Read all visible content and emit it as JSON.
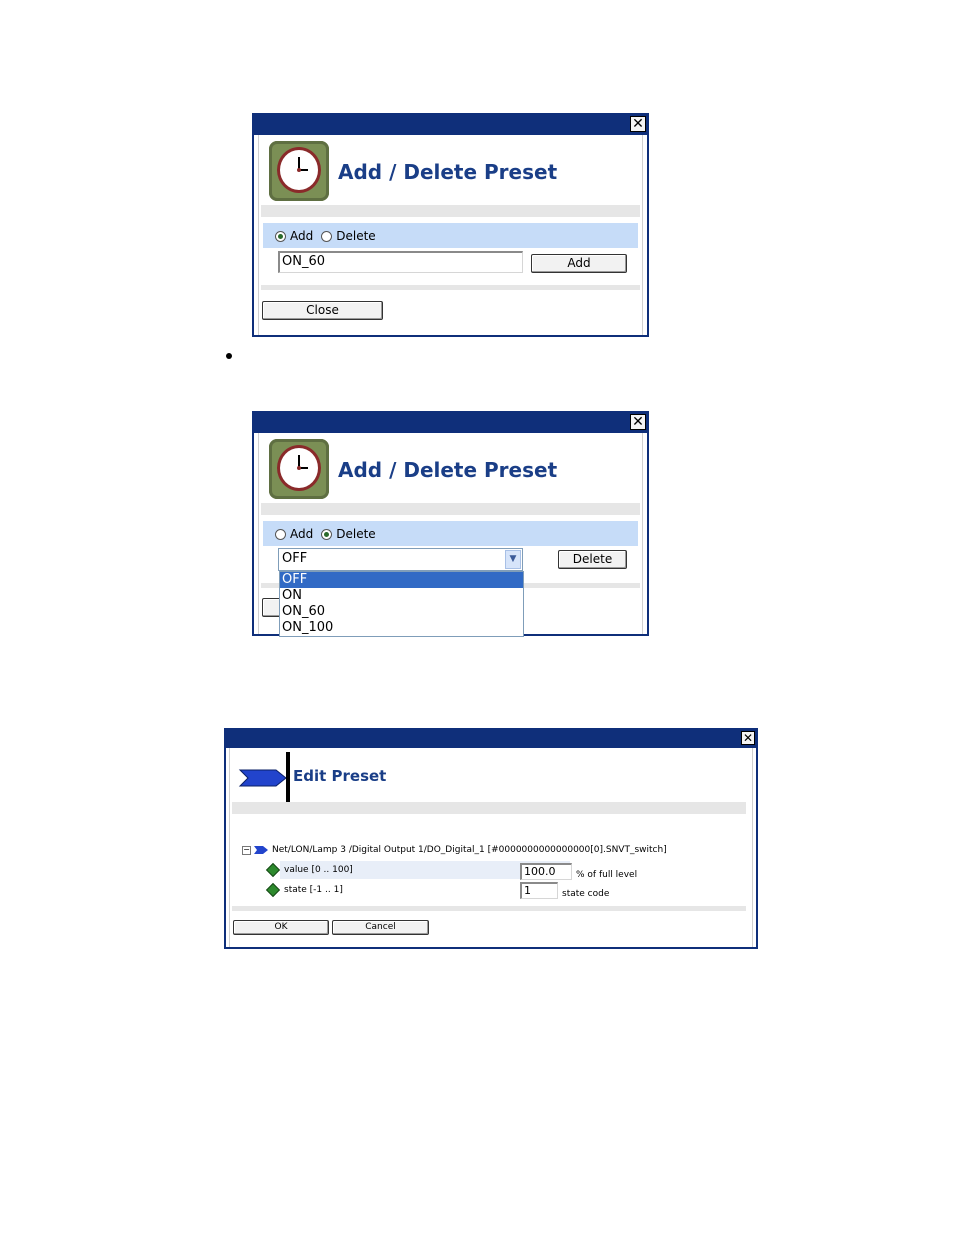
{
  "dialog1": {
    "title": "Add / Delete Preset",
    "mode_add_label": "Add",
    "mode_delete_label": "Delete",
    "selected_mode": "Add",
    "preset_name_value": "ON_60",
    "action_button_label": "Add",
    "close_button_label": "Close"
  },
  "dialog2": {
    "title": "Add / Delete Preset",
    "mode_add_label": "Add",
    "mode_delete_label": "Delete",
    "selected_mode": "Delete",
    "selected_preset": "OFF",
    "preset_options": [
      "OFF",
      "ON",
      "ON_60",
      "ON_100"
    ],
    "action_button_label": "Delete"
  },
  "dialog3": {
    "title": "Edit Preset",
    "tree_path": "Net/LON/Lamp 3 /Digital Output 1/DO_Digital_1 [#0000000000000000[0].SNVT_switch]",
    "fields": [
      {
        "label": "value [0 .. 100]",
        "value": "100.0",
        "unit": "% of full level"
      },
      {
        "label": "state [-1 .. 1]",
        "value": "1",
        "unit": "state code"
      }
    ],
    "ok_label": "OK",
    "cancel_label": "Cancel"
  },
  "icons": {
    "clock": "clock-icon",
    "close": "close-icon",
    "arrow": "arrow-icon",
    "collapse": "collapse-icon",
    "datapoint": "datapoint-icon"
  },
  "colors": {
    "titlebar": "#0f2f7a",
    "heading": "#1a3e87",
    "row_highlight": "#c6dcf8",
    "separator": "#e6e6e6",
    "list_selection": "#316ac5"
  }
}
